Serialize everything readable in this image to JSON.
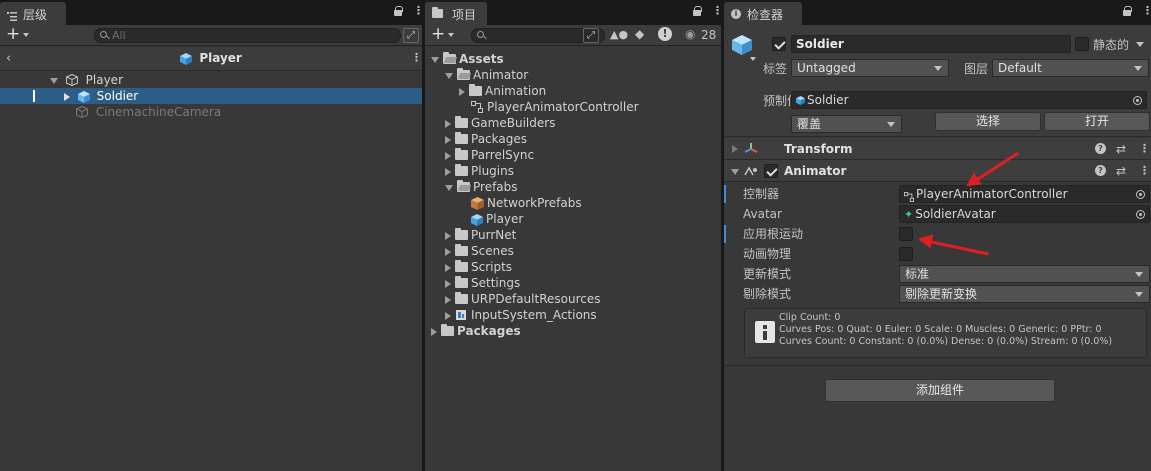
{
  "hierarchy": {
    "tab_title": "层级",
    "search_placeholder": "All",
    "scene_title": "Player",
    "items": [
      {
        "label": "Player"
      },
      {
        "label": "Soldier"
      },
      {
        "label": "CinemachineCamera"
      }
    ]
  },
  "project": {
    "tab_title": "项目",
    "badge_count": "28",
    "tree": [
      {
        "label": "Assets"
      },
      {
        "label": "Animator"
      },
      {
        "label": "Animation"
      },
      {
        "label": "PlayerAnimatorController"
      },
      {
        "label": "GameBuilders"
      },
      {
        "label": "Packages"
      },
      {
        "label": "ParrelSync"
      },
      {
        "label": "Plugins"
      },
      {
        "label": "Prefabs"
      },
      {
        "label": "NetworkPrefabs"
      },
      {
        "label": "Player"
      },
      {
        "label": "PurrNet"
      },
      {
        "label": "Scenes"
      },
      {
        "label": "Scripts"
      },
      {
        "label": "Settings"
      },
      {
        "label": "URPDefaultResources"
      },
      {
        "label": "InputSystem_Actions"
      },
      {
        "label": "Packages"
      }
    ]
  },
  "inspector": {
    "tab_title": "检查器",
    "object_name": "Soldier",
    "static_label": "静态的",
    "tag_label": "标签",
    "tag_value": "Untagged",
    "layer_label": "图层",
    "layer_value": "Default",
    "prefab_label": "预制件",
    "prefab_value": "Soldier",
    "overrides_value": "覆盖",
    "select_button": "选择",
    "open_button": "打开",
    "transform_title": "Transform",
    "animator_title": "Animator",
    "fields": {
      "controller_label": "控制器",
      "controller_value": "PlayerAnimatorController",
      "avatar_label": "Avatar",
      "avatar_value": "SoldierAvatar",
      "root_motion_label": "应用根运动",
      "physics_label": "动画物理",
      "update_mode_label": "更新模式",
      "update_mode_value": "标准",
      "culling_mode_label": "剔除模式",
      "culling_mode_value": "剔除更新变换"
    },
    "info_lines": [
      "Clip Count: 0",
      "Curves Pos: 0 Quat: 0 Euler: 0 Scale: 0 Muscles: 0 Generic: 0 PPtr: 0",
      "Curves Count: 0 Constant: 0 (0.0%) Dense: 0 (0.0%) Stream: 0 (0.0%)"
    ],
    "add_component_button": "添加组件"
  },
  "colors": {
    "selection": "#2c5d87",
    "annotation_arrow": "#e02020",
    "accent_bar": "#3d8ed2"
  }
}
